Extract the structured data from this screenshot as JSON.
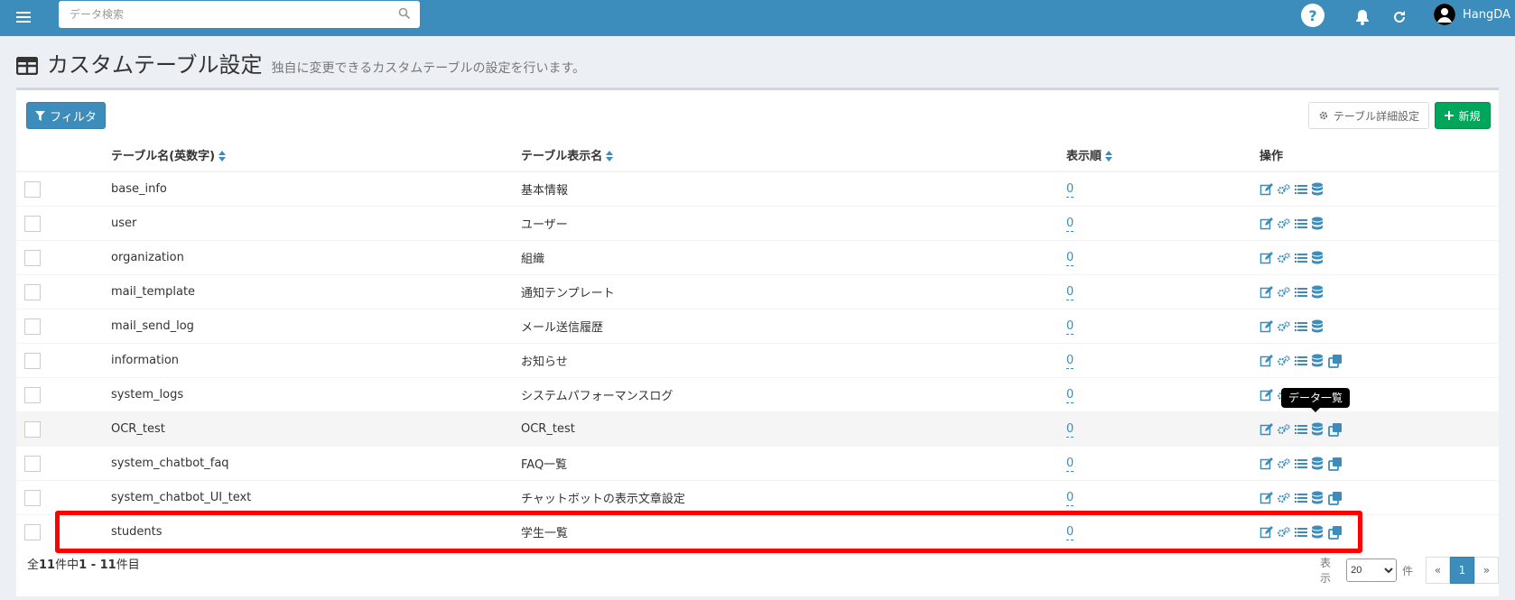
{
  "header": {
    "search_placeholder": "データ検索",
    "help_label": "?",
    "user_name": "HangDA"
  },
  "page": {
    "title": "カスタムテーブル設定",
    "subtitle": "独自に変更できるカスタムテーブルの設定を行います。"
  },
  "toolbar": {
    "filter_label": "フィルタ",
    "detail_label": "テーブル詳細設定",
    "new_label": "新規"
  },
  "table": {
    "columns": {
      "name": "テーブル名(英数字)",
      "display": "テーブル表示名",
      "order": "表示順",
      "ops": "操作"
    },
    "rows": [
      {
        "name": "base_info",
        "display": "基本情報",
        "order": "0",
        "copy": false
      },
      {
        "name": "user",
        "display": "ユーザー",
        "order": "0",
        "copy": false
      },
      {
        "name": "organization",
        "display": "組織",
        "order": "0",
        "copy": false
      },
      {
        "name": "mail_template",
        "display": "通知テンプレート",
        "order": "0",
        "copy": false
      },
      {
        "name": "mail_send_log",
        "display": "メール送信履歴",
        "order": "0",
        "copy": false
      },
      {
        "name": "information",
        "display": "お知らせ",
        "order": "0",
        "copy": true
      },
      {
        "name": "system_logs",
        "display": "システムパフォーマンスログ",
        "order": "0",
        "copy": true
      },
      {
        "name": "OCR_test",
        "display": "OCR_test",
        "order": "0",
        "copy": true
      },
      {
        "name": "system_chatbot_faq",
        "display": "FAQ一覧",
        "order": "0",
        "copy": true
      },
      {
        "name": "system_chatbot_UI_text",
        "display": "チャットボットの表示文章設定",
        "order": "0",
        "copy": true
      },
      {
        "name": "students",
        "display": "学生一覧",
        "order": "0",
        "copy": true
      }
    ]
  },
  "tooltip": {
    "text": "データ一覧"
  },
  "footer": {
    "prefix": "全",
    "total": "11",
    "middle": "件中",
    "range": "1 - 11",
    "suffix": "件目",
    "show_label": "表示",
    "per_page": "20",
    "per_page_unit": "件",
    "prev": "«",
    "page": "1",
    "next": "»"
  },
  "colors": {
    "header_bg": "#3c8dbc",
    "accent": "#3c8dbc",
    "new_button": "#00a65a",
    "highlight": "#ff0000"
  }
}
